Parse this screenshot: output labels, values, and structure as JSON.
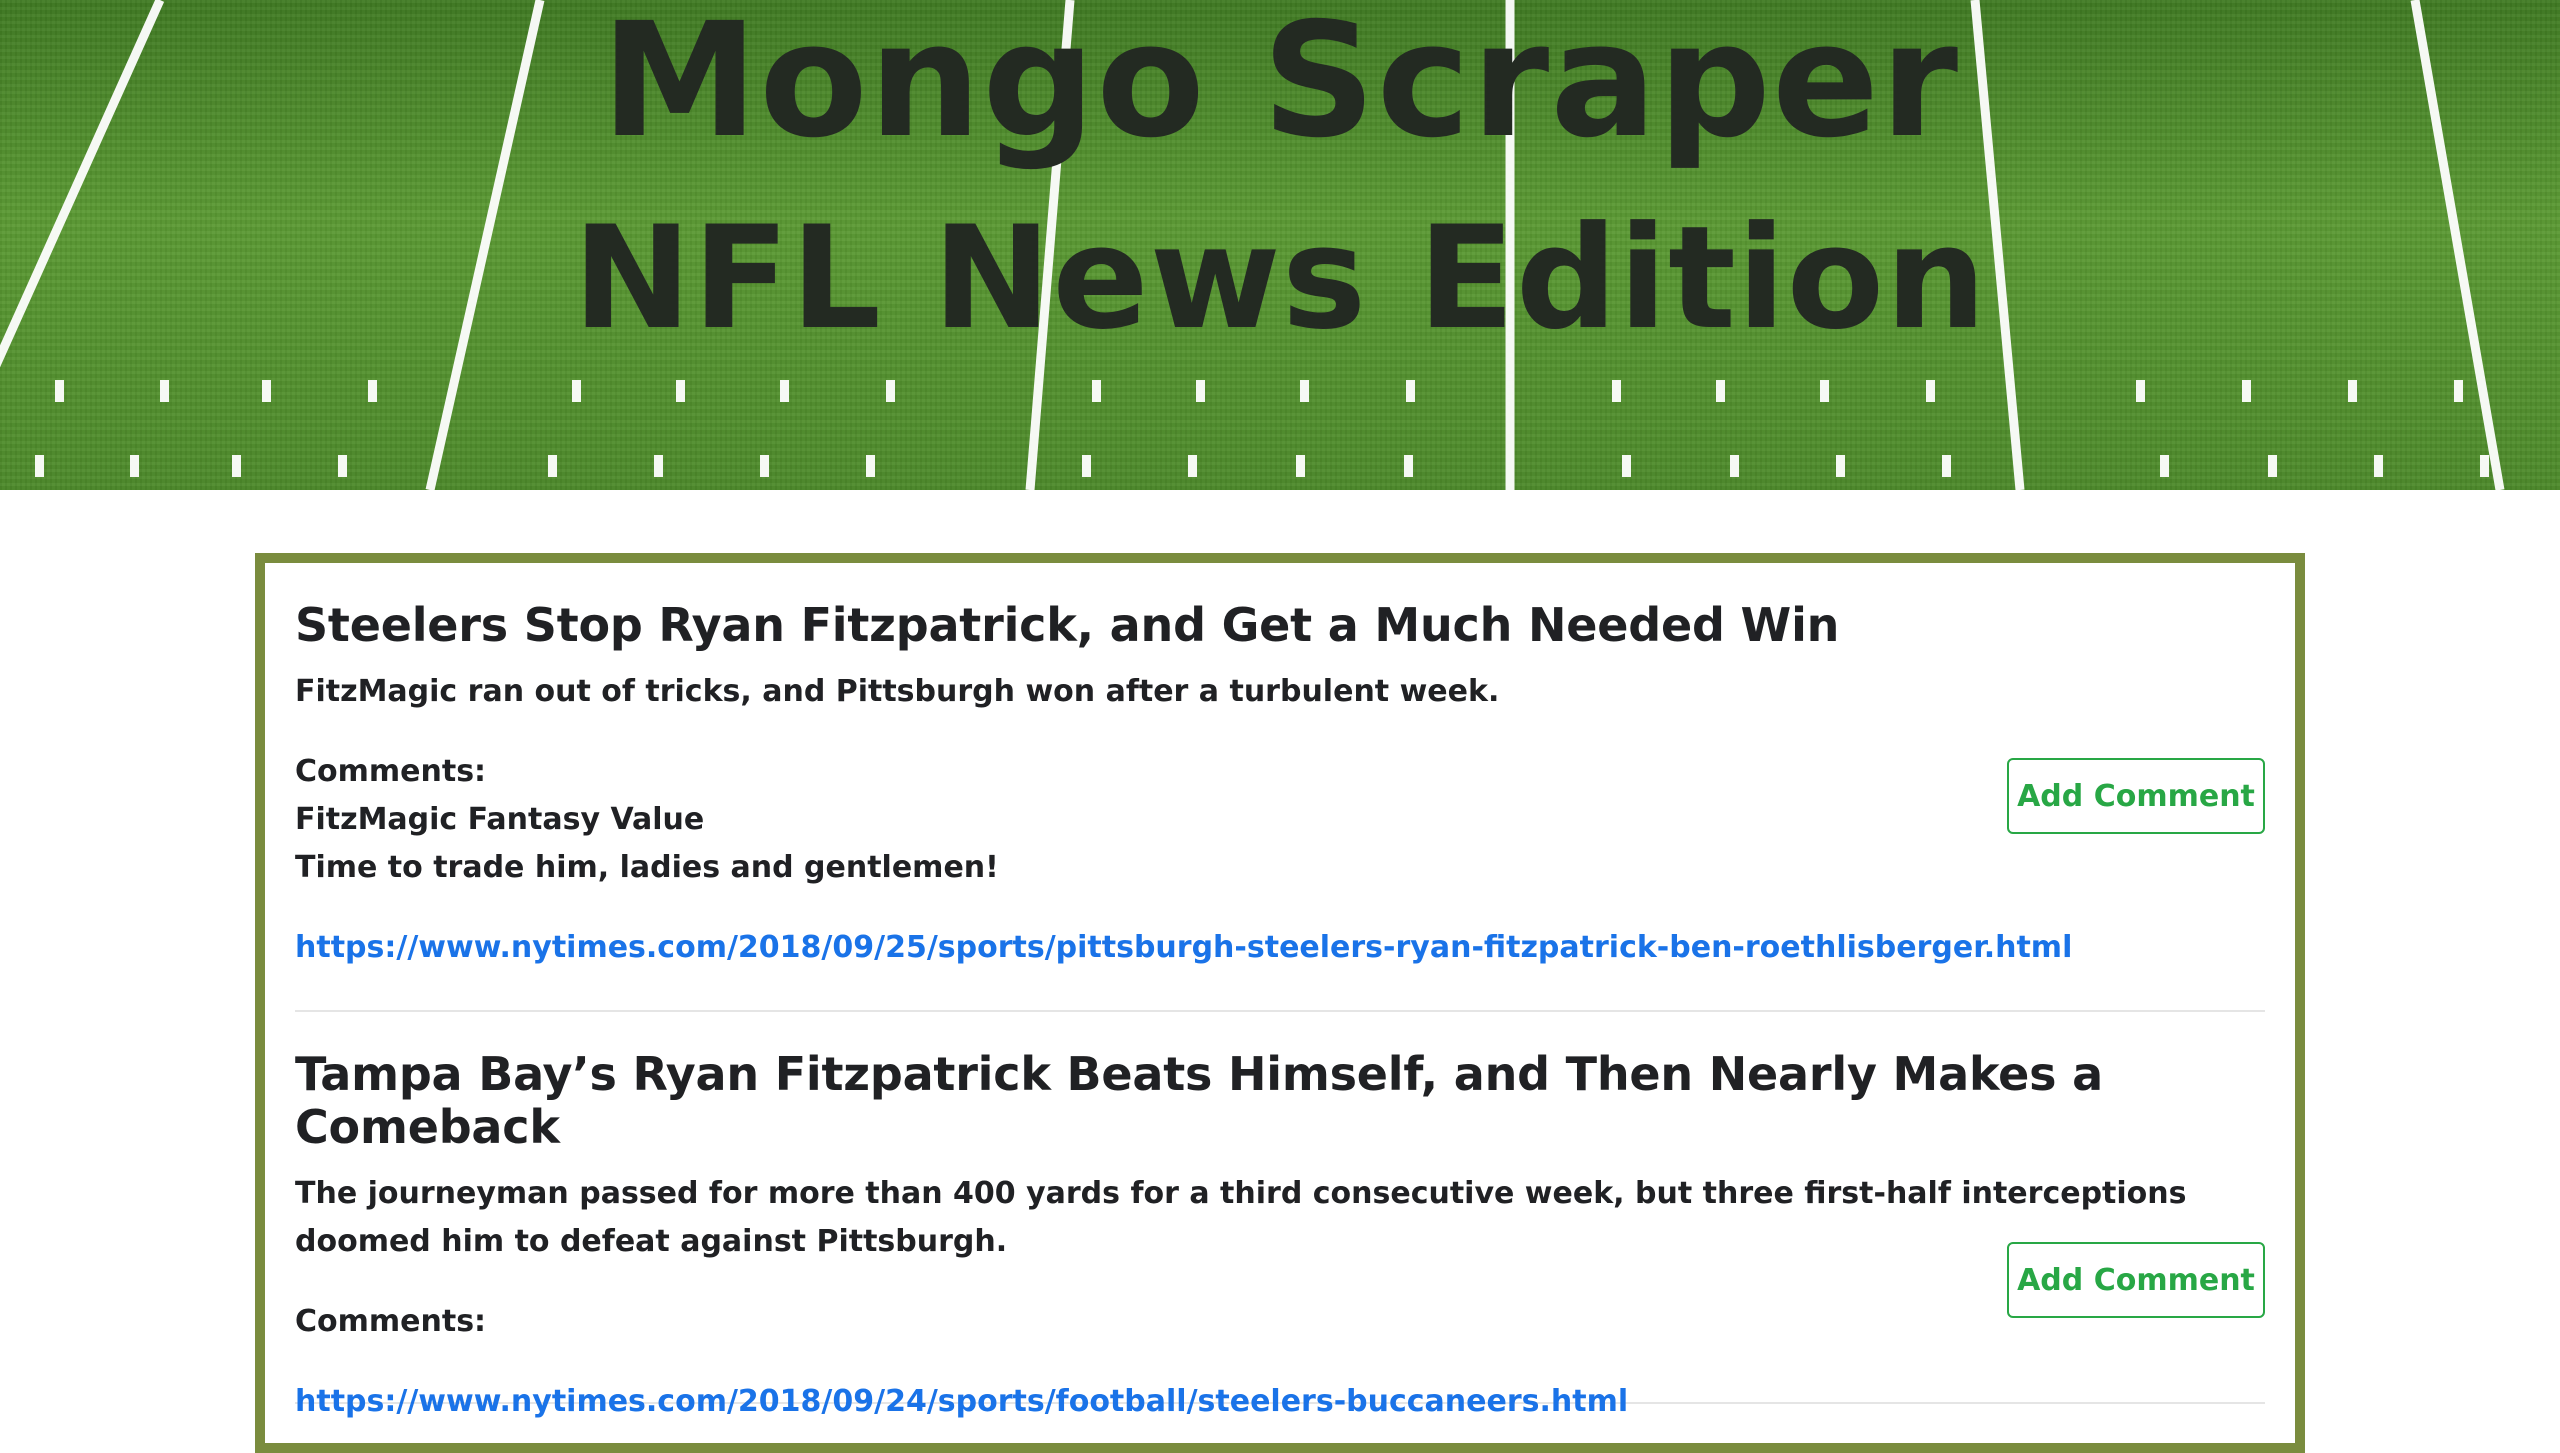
{
  "header": {
    "title_line1": "Mongo Scraper",
    "title_line2": "NFL News Edition",
    "background": "football-field-image"
  },
  "colors": {
    "card_border": "#7a8c3e",
    "link": "#1a73e8",
    "button": "#28a745",
    "text": "#202124",
    "field_green": "#4f8a2c"
  },
  "articles": [
    {
      "title": "Steelers Stop Ryan Fitzpatrick, and Get a Much Needed Win",
      "summary": "FitzMagic ran out of tricks, and Pittsburgh won after a turbulent week.",
      "comments_label": "Comments:",
      "comments": [
        "FitzMagic Fantasy Value",
        "Time to trade him, ladies and gentlemen!"
      ],
      "link": "https://www.nytimes.com/2018/09/25/sports/pittsburgh-steelers-ryan-fitzpatrick-ben-roethlisberger.html",
      "button_label": "Add Comment"
    },
    {
      "title": "Tampa Bay’s Ryan Fitzpatrick Beats Himself, and Then Nearly Makes a Comeback",
      "summary": "The journeyman passed for more than 400 yards for a third consecutive week, but three first-half interceptions doomed him to defeat against Pittsburgh.",
      "comments_label": "Comments:",
      "comments": [],
      "link": "https://www.nytimes.com/2018/09/24/sports/football/steelers-buccaneers.html",
      "button_label": "Add Comment"
    }
  ]
}
